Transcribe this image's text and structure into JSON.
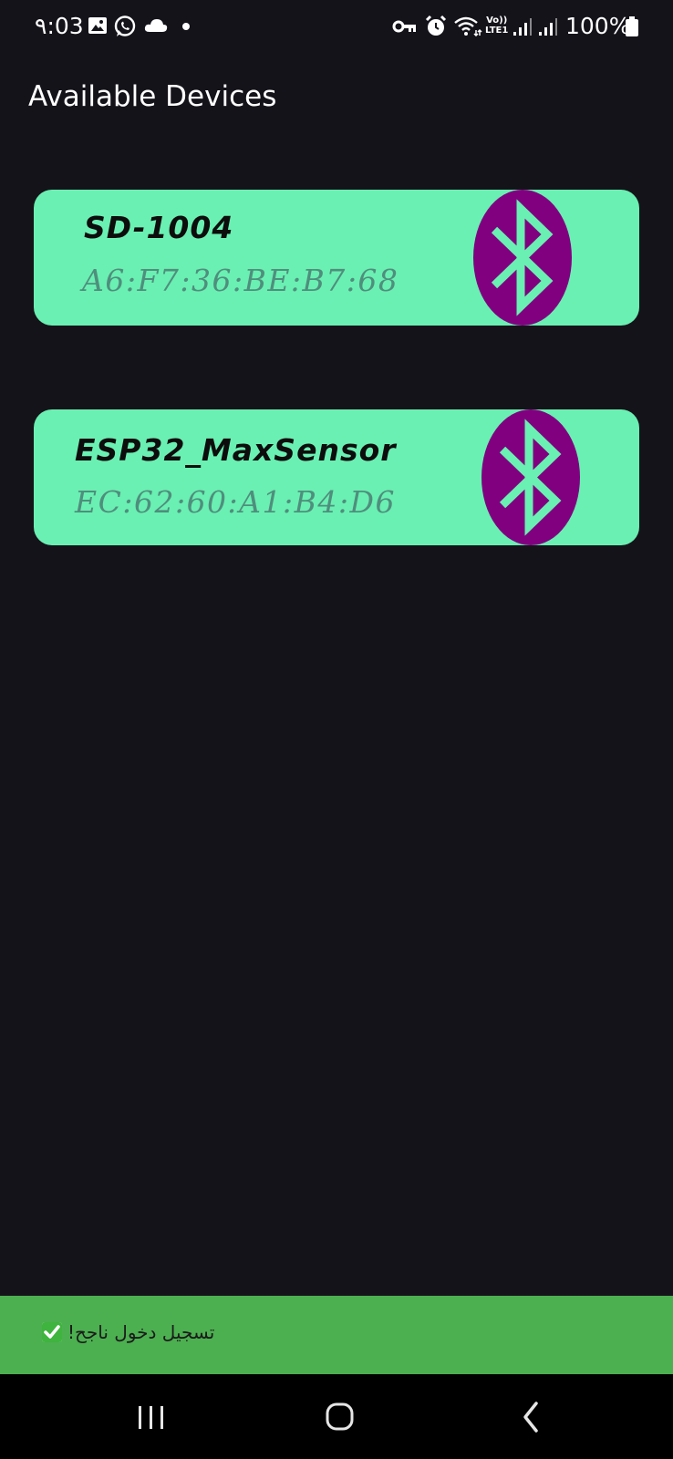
{
  "status_bar": {
    "time": "٩:03",
    "battery_percent": "100%",
    "volte_label_top": "Vo))",
    "volte_label_bottom": "LTE1",
    "icons": [
      "gallery-icon",
      "whatsapp-icon",
      "cloud-icon",
      "dot-icon",
      "vpn-key-icon",
      "alarm-icon",
      "wifi-icon",
      "signal-icon",
      "signal-icon",
      "battery-icon"
    ]
  },
  "page": {
    "title": "Available Devices"
  },
  "devices": [
    {
      "name": "SD-1004",
      "address": "A6:F7:36:BE:B7:68",
      "icon": "bluetooth-icon"
    },
    {
      "name": "ESP32_MaxSensor",
      "address": "EC:62:60:A1:B4:D6",
      "icon": "bluetooth-icon"
    }
  ],
  "snackbar": {
    "message": "تسجيل دخول ناجح!",
    "icon": "check-mark-icon"
  },
  "nav_bar": {
    "buttons": [
      "recents-icon",
      "home-icon",
      "back-icon"
    ]
  },
  "colors": {
    "background": "#15131a",
    "card": "#6af0b2",
    "bluetooth_badge": "#800080",
    "address_text": "#4f8e7d",
    "snackbar": "#4caf50"
  }
}
